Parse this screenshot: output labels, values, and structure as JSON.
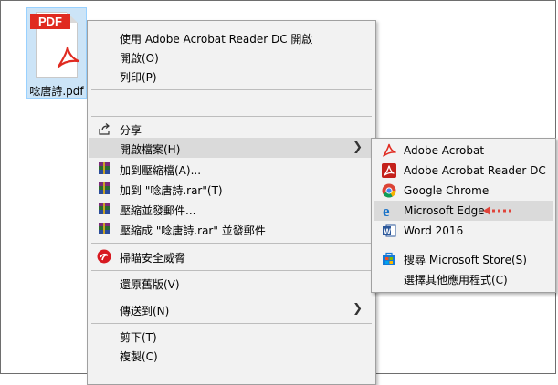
{
  "file": {
    "badge": "PDF",
    "name": "唸唐詩.pdf"
  },
  "menu": {
    "open_with_acrobat": "使用 Adobe Acrobat Reader DC 開啟",
    "open": "開啟(O)",
    "print": "列印(P)",
    "share": "分享",
    "open_with": "開啟檔案(H)",
    "add_archive": "加到壓縮檔(A)...",
    "add_rar": "加到 \"唸唐詩.rar\"(T)",
    "compress_email": "壓縮並發郵件...",
    "compress_rar_email": "壓縮成 \"唸唐詩.rar\" 並發郵件",
    "scan": "掃瞄安全威脅",
    "restore": "還原舊版(V)",
    "send_to": "傳送到(N)",
    "cut": "剪下(T)",
    "copy": "複製(C)"
  },
  "submenu": {
    "acrobat": "Adobe Acrobat",
    "acrobat_reader": "Adobe Acrobat Reader DC",
    "chrome": "Google Chrome",
    "edge": "Microsoft Edge",
    "word": "Word 2016",
    "store": "搜尋 Microsoft Store(S)",
    "other": "選擇其他應用程式(C)"
  },
  "icons": {
    "pdf": "acrobat-icon",
    "share": "share-icon",
    "winrar": "winrar-icon",
    "trend": "trend-micro-icon",
    "chrome": "chrome-icon",
    "edge": "edge-icon",
    "word": "word-icon",
    "store": "store-icon"
  },
  "colors": {
    "pdf_red": "#e02a20",
    "highlight": "#dadada",
    "menu_bg": "#f2f2f2",
    "pointer": "#e0443a"
  }
}
